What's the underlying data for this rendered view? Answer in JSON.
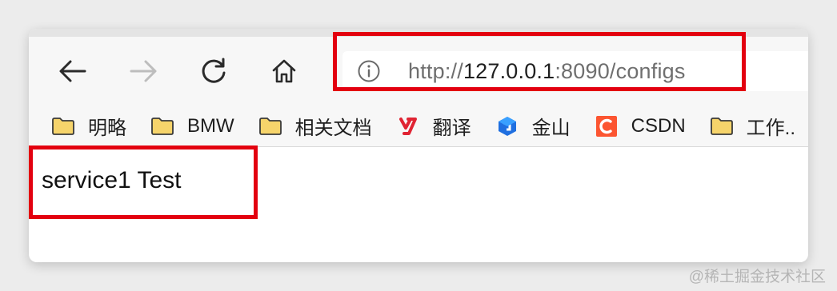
{
  "browser": {
    "address_bar": {
      "url_scheme": "http://",
      "url_host": "127.0.0.1",
      "url_rest": ":8090/configs"
    },
    "bookmarks": [
      {
        "label": "明略",
        "icon": "folder-icon"
      },
      {
        "label": "BMW",
        "icon": "folder-icon"
      },
      {
        "label": "相关文档",
        "icon": "folder-icon"
      },
      {
        "label": "翻译",
        "icon": "youdao-icon"
      },
      {
        "label": "金山",
        "icon": "kingsoft-icon"
      },
      {
        "label": "CSDN",
        "icon": "csdn-icon"
      },
      {
        "label": "工作..",
        "icon": "folder-icon"
      }
    ],
    "colors": {
      "highlight": "#e3000f",
      "folder": "#f6d46b",
      "csdn": "#fc5531"
    }
  },
  "page": {
    "body_text": "service1 Test"
  },
  "watermark": "@稀土掘金技术社区"
}
